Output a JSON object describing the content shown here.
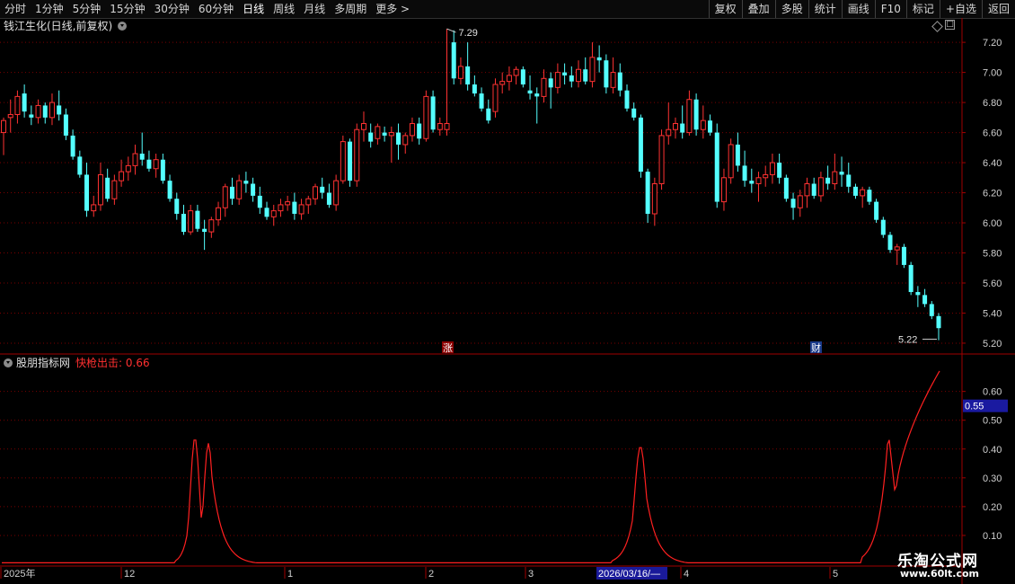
{
  "toolbar": {
    "periods": [
      "分时",
      "1分钟",
      "5分钟",
      "15分钟",
      "30分钟",
      "60分钟",
      "日线",
      "周线",
      "月线",
      "多周期",
      "更多 >"
    ],
    "active_period": "日线",
    "actions": [
      "复权",
      "叠加",
      "多股",
      "统计",
      "画线",
      "F10",
      "标记",
      "+自选",
      "返回"
    ]
  },
  "main_chart": {
    "title": "钱江生化(日线,前复权)",
    "y_ticks": [
      "7.20",
      "7.00",
      "6.80",
      "6.60",
      "6.40",
      "6.20",
      "6.00",
      "5.80",
      "5.60",
      "5.40",
      "5.20"
    ],
    "high_label": "7.29",
    "low_label": "5.22",
    "event_markers": [
      "涨",
      "财"
    ]
  },
  "indicator": {
    "name": "股朋指标网",
    "value_label": "快枪出击: 0.66",
    "current_value": "0.55",
    "y_ticks": [
      "0.60",
      "0.50",
      "0.40",
      "0.30",
      "0.20",
      "0.10"
    ]
  },
  "time_axis": {
    "labels": [
      "2025年",
      "12",
      "1",
      "2",
      "3",
      "2026/03/16/—",
      "4",
      "5"
    ]
  },
  "watermark": {
    "line1": "乐淘公式网",
    "line2": "www.60lt.com"
  },
  "colors": {
    "up": "#ff3232",
    "down": "#54ffff",
    "indicator": "#ff2020",
    "grid": "#7a0000"
  },
  "chart_data": {
    "type": "candlestick",
    "title": "钱江生化(日线,前复权)",
    "y_range": [
      5.14,
      7.35
    ],
    "high": 7.29,
    "low": 5.22,
    "candles_ohlc": [
      [
        6.6,
        6.7,
        6.45,
        6.68
      ],
      [
        6.7,
        6.82,
        6.6,
        6.72
      ],
      [
        6.72,
        6.88,
        6.66,
        6.84
      ],
      [
        6.86,
        6.92,
        6.7,
        6.74
      ],
      [
        6.72,
        6.78,
        6.65,
        6.7
      ],
      [
        6.7,
        6.82,
        6.66,
        6.78
      ],
      [
        6.78,
        6.8,
        6.66,
        6.7
      ],
      [
        6.7,
        6.86,
        6.65,
        6.8
      ],
      [
        6.78,
        6.88,
        6.68,
        6.72
      ],
      [
        6.72,
        6.76,
        6.55,
        6.58
      ],
      [
        6.58,
        6.62,
        6.42,
        6.44
      ],
      [
        6.44,
        6.48,
        6.3,
        6.32
      ],
      [
        6.32,
        6.4,
        6.04,
        6.08
      ],
      [
        6.08,
        6.18,
        6.04,
        6.12
      ],
      [
        6.12,
        6.4,
        6.08,
        6.32
      ],
      [
        6.3,
        6.36,
        6.14,
        6.16
      ],
      [
        6.16,
        6.32,
        6.12,
        6.28
      ],
      [
        6.28,
        6.42,
        6.24,
        6.34
      ],
      [
        6.34,
        6.44,
        6.28,
        6.38
      ],
      [
        6.38,
        6.52,
        6.32,
        6.46
      ],
      [
        6.46,
        6.6,
        6.38,
        6.42
      ],
      [
        6.42,
        6.48,
        6.34,
        6.36
      ],
      [
        6.36,
        6.46,
        6.3,
        6.42
      ],
      [
        6.42,
        6.46,
        6.26,
        6.28
      ],
      [
        6.28,
        6.32,
        6.14,
        6.16
      ],
      [
        6.16,
        6.2,
        6.02,
        6.06
      ],
      [
        6.06,
        6.12,
        5.92,
        5.94
      ],
      [
        5.94,
        6.12,
        5.92,
        6.08
      ],
      [
        6.08,
        6.12,
        5.94,
        5.96
      ],
      [
        5.96,
        6.02,
        5.82,
        5.94
      ],
      [
        5.94,
        6.04,
        5.9,
        6.02
      ],
      [
        6.02,
        6.14,
        5.98,
        6.1
      ],
      [
        6.1,
        6.26,
        6.04,
        6.24
      ],
      [
        6.24,
        6.3,
        6.12,
        6.16
      ],
      [
        6.16,
        6.32,
        6.12,
        6.28
      ],
      [
        6.28,
        6.34,
        6.2,
        6.26
      ],
      [
        6.26,
        6.3,
        6.14,
        6.18
      ],
      [
        6.18,
        6.24,
        6.06,
        6.1
      ],
      [
        6.1,
        6.14,
        6.02,
        6.04
      ],
      [
        6.04,
        6.12,
        5.98,
        6.08
      ],
      [
        6.08,
        6.16,
        6.04,
        6.12
      ],
      [
        6.12,
        6.18,
        6.08,
        6.14
      ],
      [
        6.14,
        6.2,
        6.02,
        6.06
      ],
      [
        6.06,
        6.16,
        6.02,
        6.12
      ],
      [
        6.12,
        6.18,
        6.06,
        6.16
      ],
      [
        6.16,
        6.26,
        6.12,
        6.24
      ],
      [
        6.24,
        6.3,
        6.16,
        6.2
      ],
      [
        6.2,
        6.26,
        6.1,
        6.12
      ],
      [
        6.12,
        6.32,
        6.08,
        6.28
      ],
      [
        6.28,
        6.58,
        6.26,
        6.54
      ],
      [
        6.54,
        6.56,
        6.24,
        6.28
      ],
      [
        6.28,
        6.66,
        6.24,
        6.62
      ],
      [
        6.62,
        6.74,
        6.54,
        6.66
      ],
      [
        6.6,
        6.66,
        6.5,
        6.54
      ],
      [
        6.56,
        6.66,
        6.52,
        6.64
      ],
      [
        6.6,
        6.64,
        6.54,
        6.58
      ],
      [
        6.58,
        6.64,
        6.4,
        6.6
      ],
      [
        6.6,
        6.66,
        6.42,
        6.52
      ],
      [
        6.52,
        6.6,
        6.46,
        6.58
      ],
      [
        6.58,
        6.7,
        6.54,
        6.66
      ],
      [
        6.66,
        6.7,
        6.52,
        6.56
      ],
      [
        6.56,
        6.88,
        6.54,
        6.84
      ],
      [
        6.84,
        6.88,
        6.6,
        6.62
      ],
      [
        6.62,
        6.7,
        6.58,
        6.66
      ],
      [
        6.62,
        7.29,
        6.58,
        6.66
      ],
      [
        7.2,
        7.28,
        6.92,
        6.96
      ],
      [
        6.96,
        7.1,
        6.92,
        7.04
      ],
      [
        7.04,
        7.2,
        6.88,
        6.92
      ],
      [
        6.92,
        6.98,
        6.84,
        6.86
      ],
      [
        6.86,
        6.9,
        6.74,
        6.76
      ],
      [
        6.76,
        6.82,
        6.66,
        6.68
      ],
      [
        6.74,
        6.96,
        6.7,
        6.92
      ],
      [
        6.92,
        7.0,
        6.86,
        6.94
      ],
      [
        6.94,
        7.04,
        6.88,
        6.98
      ],
      [
        6.98,
        7.04,
        6.92,
        7.02
      ],
      [
        7.02,
        7.04,
        6.9,
        6.92
      ],
      [
        6.88,
        6.98,
        6.82,
        6.86
      ],
      [
        6.86,
        6.9,
        6.66,
        6.84
      ],
      [
        6.84,
        7.02,
        6.8,
        6.96
      ],
      [
        6.96,
        7.0,
        6.76,
        6.9
      ],
      [
        6.9,
        7.06,
        6.86,
        7.0
      ],
      [
        7.0,
        7.06,
        6.92,
        6.98
      ],
      [
        6.98,
        7.04,
        6.9,
        6.94
      ],
      [
        6.94,
        7.08,
        6.9,
        7.02
      ],
      [
        7.02,
        7.1,
        6.92,
        6.94
      ],
      [
        6.94,
        7.2,
        6.9,
        7.1
      ],
      [
        7.1,
        7.18,
        7.0,
        7.08
      ],
      [
        7.08,
        7.12,
        6.86,
        6.9
      ],
      [
        6.9,
        7.1,
        6.86,
        7.0
      ],
      [
        7.0,
        7.06,
        6.84,
        6.88
      ],
      [
        6.88,
        6.92,
        6.74,
        6.76
      ],
      [
        6.76,
        6.8,
        6.68,
        6.7
      ],
      [
        6.7,
        6.72,
        6.3,
        6.34
      ],
      [
        6.34,
        6.36,
        6.0,
        6.06
      ],
      [
        6.06,
        6.3,
        5.98,
        6.26
      ],
      [
        6.26,
        6.62,
        6.22,
        6.58
      ],
      [
        6.58,
        6.8,
        6.52,
        6.62
      ],
      [
        6.62,
        6.7,
        6.56,
        6.66
      ],
      [
        6.66,
        6.78,
        6.56,
        6.6
      ],
      [
        6.6,
        6.88,
        6.58,
        6.82
      ],
      [
        6.82,
        6.86,
        6.58,
        6.62
      ],
      [
        6.62,
        6.78,
        6.56,
        6.68
      ],
      [
        6.68,
        6.72,
        6.58,
        6.6
      ],
      [
        6.6,
        6.66,
        6.1,
        6.14
      ],
      [
        6.14,
        6.36,
        6.08,
        6.3
      ],
      [
        6.3,
        6.56,
        6.26,
        6.52
      ],
      [
        6.52,
        6.6,
        6.34,
        6.38
      ],
      [
        6.38,
        6.48,
        6.24,
        6.28
      ],
      [
        6.28,
        6.36,
        6.2,
        6.26
      ],
      [
        6.26,
        6.34,
        6.14,
        6.3
      ],
      [
        6.3,
        6.38,
        6.24,
        6.32
      ],
      [
        6.32,
        6.46,
        6.26,
        6.4
      ],
      [
        6.4,
        6.46,
        6.26,
        6.3
      ],
      [
        6.3,
        6.32,
        6.14,
        6.16
      ],
      [
        6.16,
        6.2,
        6.02,
        6.1
      ],
      [
        6.1,
        6.22,
        6.04,
        6.18
      ],
      [
        6.18,
        6.3,
        6.1,
        6.26
      ],
      [
        6.26,
        6.3,
        6.16,
        6.18
      ],
      [
        6.18,
        6.34,
        6.14,
        6.3
      ],
      [
        6.3,
        6.38,
        6.22,
        6.26
      ],
      [
        6.26,
        6.46,
        6.22,
        6.34
      ],
      [
        6.34,
        6.44,
        6.24,
        6.32
      ],
      [
        6.32,
        6.4,
        6.2,
        6.24
      ],
      [
        6.24,
        6.26,
        6.16,
        6.18
      ],
      [
        6.18,
        6.24,
        6.1,
        6.22
      ],
      [
        6.22,
        6.24,
        6.12,
        6.14
      ],
      [
        6.14,
        6.16,
        6.0,
        6.02
      ],
      [
        6.02,
        6.04,
        5.9,
        5.92
      ],
      [
        5.92,
        5.94,
        5.8,
        5.82
      ],
      [
        5.82,
        5.86,
        5.72,
        5.84
      ],
      [
        5.84,
        5.86,
        5.7,
        5.72
      ],
      [
        5.72,
        5.74,
        5.52,
        5.54
      ],
      [
        5.54,
        5.58,
        5.44,
        5.52
      ],
      [
        5.52,
        5.56,
        5.44,
        5.46
      ],
      [
        5.46,
        5.48,
        5.36,
        5.38
      ],
      [
        5.38,
        5.4,
        5.22,
        5.3
      ]
    ],
    "indicator_series": {
      "name": "快枪出击",
      "y_range": [
        0.0,
        0.68
      ],
      "values": [
        0,
        0,
        0,
        0,
        0,
        0,
        0,
        0,
        0,
        0,
        0,
        0,
        0,
        0,
        0,
        0,
        0,
        0,
        0,
        0,
        0,
        0,
        0,
        0,
        0,
        0,
        0,
        0,
        0,
        0,
        0,
        0,
        0,
        0,
        0,
        0,
        0,
        0,
        0,
        0,
        0,
        0,
        0,
        0,
        0,
        0,
        0,
        0,
        0,
        0,
        0,
        0,
        0,
        0,
        0,
        0,
        0,
        0,
        0,
        0,
        0,
        0,
        0,
        0,
        0,
        0,
        0,
        0,
        0,
        0,
        0,
        0,
        0,
        0,
        0,
        0,
        0,
        0,
        0,
        0,
        0,
        0,
        0,
        0,
        0,
        0,
        0,
        0,
        0,
        0,
        0,
        0,
        0,
        0,
        0,
        0,
        0,
        0,
        0,
        0,
        0,
        0,
        0,
        0,
        0,
        0,
        0,
        0,
        0,
        0,
        0,
        0,
        0,
        0,
        0,
        0,
        0,
        0,
        0,
        0,
        0,
        0,
        0,
        0,
        0,
        0,
        0,
        0,
        0,
        0,
        0,
        0,
        0,
        0,
        0,
        0,
        0,
        0,
        0,
        0,
        0
      ],
      "peaks": [
        {
          "x": 217,
          "y": 0.44
        },
        {
          "x": 225,
          "y": 0.22
        },
        {
          "x": 232,
          "y": 0.42
        },
        {
          "x": 713,
          "y": 0.41
        },
        {
          "x": 989,
          "y": 0.46
        },
        {
          "x": 997,
          "y": 0.23
        },
        {
          "x": 1044,
          "y": 0.66
        }
      ]
    }
  }
}
